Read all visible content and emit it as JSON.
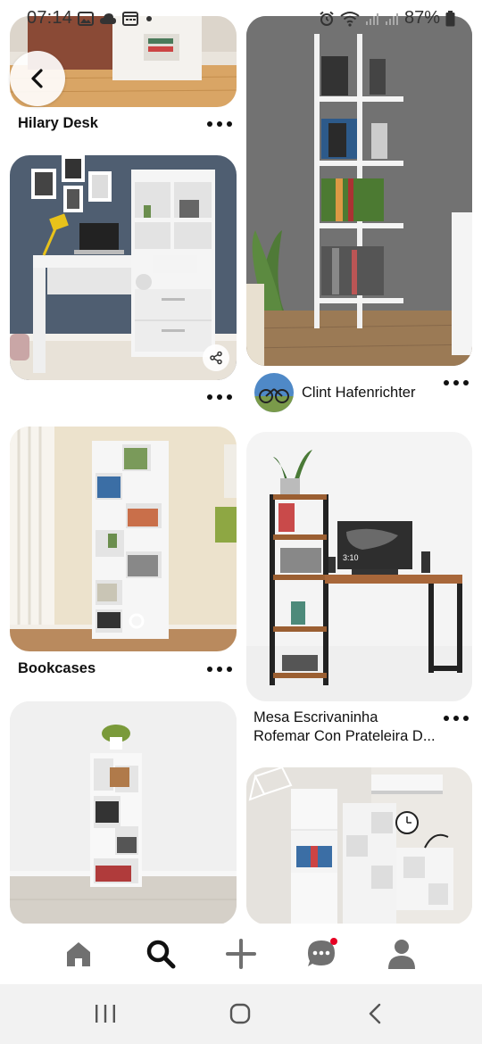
{
  "status_bar": {
    "time": "07:14",
    "left_icons": [
      "gallery-icon",
      "cloud-icon",
      "calendar-icon",
      "dot-icon"
    ],
    "right_icons": [
      "alarm-icon",
      "wifi-icon",
      "signal-icon",
      "signal-icon-2",
      "battery-icon"
    ],
    "battery": "87%"
  },
  "feed": {
    "pins": [
      {
        "title": "Hilary Desk"
      },
      {
        "title": ""
      },
      {
        "title": "Bookcases"
      },
      {
        "title": ""
      },
      {
        "author": "Clint Hafenrichter"
      },
      {
        "title_line1": "Mesa Escrivaninha",
        "title_line2": "Rofemar Con Prateleira D..."
      },
      {
        "title": ""
      }
    ],
    "desk_image_text": "3:10"
  },
  "bottom_nav": {
    "items": [
      "home-icon",
      "search-icon",
      "add-icon",
      "messages-icon",
      "profile-icon"
    ],
    "accent": "#e60023"
  },
  "system_nav": {
    "items": [
      "recents-icon",
      "home-button-icon",
      "back-icon"
    ]
  },
  "colors": {
    "background": "#ffffff",
    "text": "#111111",
    "system_bar": "#f2f2f2",
    "notification": "#e60023"
  }
}
